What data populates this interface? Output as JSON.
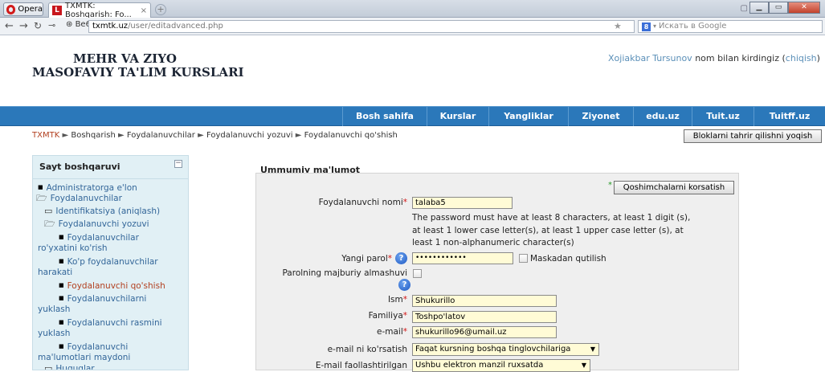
{
  "browser": {
    "opera_label": "Opera",
    "tab_title": "TXMTK: Boshqarish: Fo...",
    "tab_close": "×",
    "new_tab": "+",
    "be6": "Be6",
    "url_host": "txmtk.uz",
    "url_path": "/user/editadvanced.php",
    "search_placeholder": "Искать в Google"
  },
  "site": {
    "logo_line1": "MEHR VA ZIYO",
    "logo_line2": "MASOFAVIY TA'LIM KURSLARI",
    "user_name": "Xojiakbar Tursunov",
    "login_text": " nom bilan kirdingiz (",
    "logout_link": "chiqish",
    "login_close": ")"
  },
  "menu": [
    "Bosh sahifa",
    "Kurslar",
    "Yangliklar",
    "Ziyonet",
    "edu.uz",
    "Tuit.uz",
    "Tuitff.uz"
  ],
  "breadcrumb": {
    "items": [
      "TXMTK",
      "Boshqarish",
      "Foydalanuvchilar",
      "Foydalanuvchi yozuvi",
      "Foydalanuvchi qo'shish"
    ],
    "separator": "►"
  },
  "edit_blocks_button": "Bloklarni tahrir qilishni yoqish",
  "sidebar": {
    "title": "Sayt boshqaruvi",
    "collapse": "−",
    "items": [
      "Administratorga e'lon",
      "Foydalanuvchilar",
      "Identifikatsiya (aniqlash)",
      "Foydalanuvchi yozuvi",
      "Foydalanuvchilar",
      "ro'yxatini ko'rish",
      "Ko'p foydalanuvchilar",
      "harakati",
      "Foydalanuvchi qo'shish",
      "Foydalanuvchilarni",
      "yuklash",
      "Foydalanuvchi rasmini",
      "yuklash",
      "Foydalanuvchi",
      "ma'lumotlari maydoni",
      "Huquqlar"
    ]
  },
  "form": {
    "legend": "Ummumiy ma'lumot",
    "show_more": "Qoshimchalarni korsatish",
    "username_label": "Foydalanuvchi nomi",
    "username_value": "talaba5",
    "password_note": "The password must have at least 8 characters, at least 1 digit (s), at least 1 lower case letter(s), at least 1 upper case letter (s), at least 1 non-alphanumeric character(s)",
    "password_label": "Yangi parol",
    "password_value": "••••••••••••",
    "unmask_label": "Maskadan qutilish",
    "force_change_label": "Parolning majburiy almashuvi",
    "firstname_label": "Ism",
    "firstname_value": "Shukurillo",
    "lastname_label": "Familiya",
    "lastname_value": "Toshpo'latov",
    "email_label": "e-mail",
    "email_value": "shukurillo96@umail.uz",
    "email_display_label": "e-mail ni ko'rsatish",
    "email_display_value": "Faqat kursning boshqa tinglovchilariga",
    "email_active_label": "E-mail faollashtirilgan",
    "email_active_value": "Ushbu elektron manzil ruxsatda",
    "required_mark": "*",
    "help_mark": "?"
  }
}
